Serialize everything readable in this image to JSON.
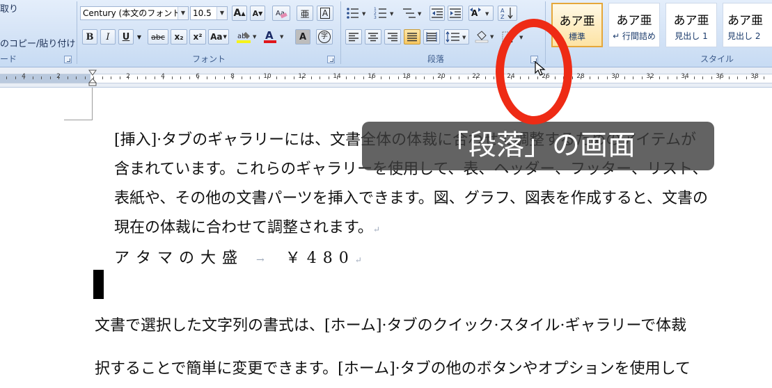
{
  "clipboard": {
    "item1": "取り",
    "item2": "のコピー/貼り付け",
    "caption": "ード"
  },
  "font": {
    "name": "Century (本文のフォント",
    "size": "10.5",
    "caption": "フォント",
    "buttons": {
      "grow": "A",
      "shrink": "A",
      "bold": "B",
      "italic": "I",
      "underline": "U",
      "strike": "abc",
      "subscript": "x₂",
      "superscript": "x²",
      "change_case": "Aa",
      "font_color": "A",
      "char_shading": "A",
      "char_border": "A",
      "enclose": "字",
      "phonetic": "亜"
    }
  },
  "paragraph": {
    "caption": "段落",
    "sort": "A↓Z"
  },
  "styles": {
    "caption": "スタイル",
    "items": [
      {
        "sample": "あア亜",
        "label": "標準"
      },
      {
        "sample": "あア亜",
        "label": "↵ 行間詰め"
      },
      {
        "sample": "あア亜",
        "label": "見出し 1"
      },
      {
        "sample": "あア亜",
        "label": "見出し 2"
      }
    ]
  },
  "ruler": {
    "numbers": [
      "4",
      "2",
      "2",
      "4",
      "6",
      "8",
      "10",
      "12",
      "14",
      "16",
      "18",
      "20",
      "22",
      "24",
      "26",
      "28",
      "30",
      "32",
      "34",
      "36",
      "38"
    ]
  },
  "document": {
    "lines": [
      "[挿入]·タブのギャラリーには、文書全体の体裁に合わせて調整するためのアイテムが",
      "含まれています。これらのギャラリーを使用して、表、ヘッダー、フッター、リスト、",
      "表紙や、その他の文書パーツを挿入できます。図、グラフ、図表を作成すると、文書の",
      "現在の体裁に合わせて調整されます。"
    ],
    "menu_line": "アタマの大盛",
    "tab_arrow": "→",
    "price": "￥480",
    "para2_line1": "文書で選択した文字列の書式は、[ホーム]·タブのクイック·スタイル·ギャラリーで体裁",
    "para2_line2": "択することで簡単に変更できます。[ホーム]·タブの他のボタンやオプションを使用して"
  },
  "overlay": {
    "caption": "「段落」の画面"
  },
  "colors": {
    "highlight_circle": "#ee2b15",
    "ribbon_bg": "#d4e3f6",
    "caption_bg": "#3c3c3c"
  }
}
